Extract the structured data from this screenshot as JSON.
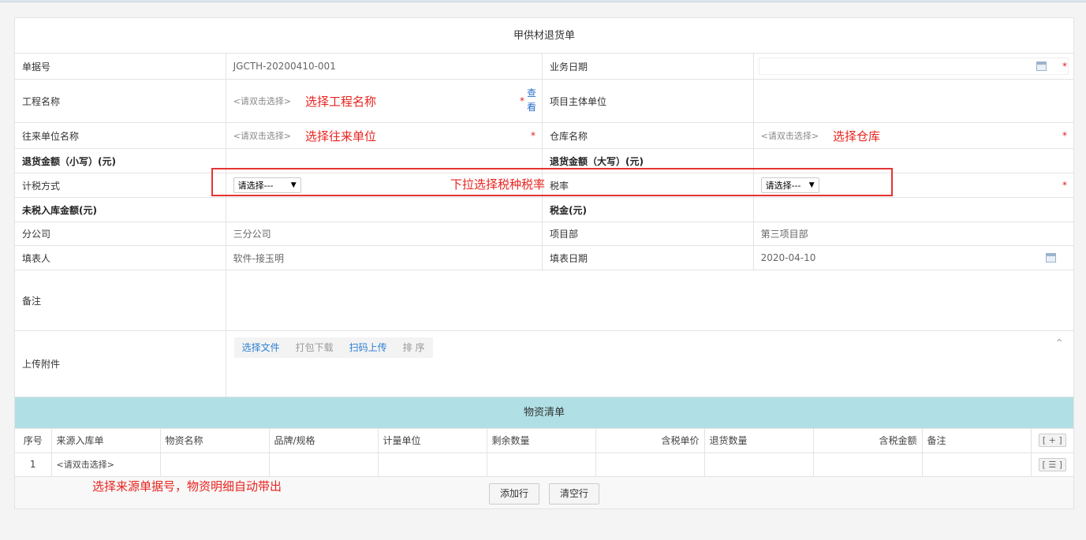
{
  "form": {
    "title": "甲供材退货单",
    "rows": {
      "doc_no_label": "单据号",
      "doc_no_value": "JGCTH-20200410-001",
      "biz_date_label": "业务日期",
      "project_name_label": "工程名称",
      "project_name_placeholder": "<请双击选择>",
      "project_name_note": "选择工程名称",
      "view_link": "查看",
      "project_owner_label": "项目主体单位",
      "partner_label": "往来单位名称",
      "partner_placeholder": "<请双击选择>",
      "partner_note": "选择往来单位",
      "warehouse_label": "仓库名称",
      "warehouse_placeholder": "<请双击选择>",
      "warehouse_note": "选择仓库",
      "return_amount_small_label": "退货金额（小写）(元)",
      "return_amount_big_label": "退货金额（大写）(元)",
      "tax_method_label": "计税方式",
      "tax_method_selected": "请选择---",
      "tax_rate_label": "税率",
      "tax_rate_selected": "请选择---",
      "untaxed_amount_label": "未税入库金额(元)",
      "tax_amount_label": "税金(元)",
      "branch_label": "分公司",
      "branch_value": "三分公司",
      "dept_label": "项目部",
      "dept_value": "第三项目部",
      "filler_label": "填表人",
      "filler_value": "软件-接玉明",
      "fill_date_label": "填表日期",
      "fill_date_value": "2020-04-10",
      "remark_label": "备注",
      "attachment_label": "上传附件"
    },
    "required_mark": "*",
    "upload_buttons": {
      "select_file": "选择文件",
      "pack_download": "打包下载",
      "scan_upload": "扫码上传",
      "sort": "排 序"
    }
  },
  "items": {
    "section_title": "物资清单",
    "columns": [
      "序号",
      "来源入库单",
      "物资名称",
      "品牌/规格",
      "计量单位",
      "剩余数量",
      "含税单价",
      "退货数量",
      "含税金额",
      "备注"
    ],
    "add_button": "[ + ]",
    "menu_button": "[ ☰ ]",
    "rows": [
      {
        "index": "1",
        "source": "<请双击选择>"
      }
    ],
    "add_row_button": "添加行",
    "clear_rows_button": "清空行"
  },
  "annotations": {
    "dropdown_note": "下拉选择税种税率",
    "source_note": "选择来源单据号，物资明细自动带出"
  },
  "colors": {
    "annotation_red": "#e8231e",
    "section_header": "#b0dfe5",
    "link_blue": "#2a7fd4"
  }
}
